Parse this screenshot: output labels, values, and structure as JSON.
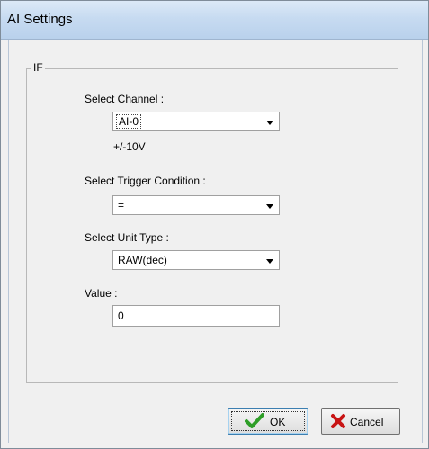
{
  "window": {
    "title": "AI Settings"
  },
  "group": {
    "label": "IF"
  },
  "channel": {
    "label": "Select Channel :",
    "value": "AI-0",
    "range_text": "+/-10V"
  },
  "trigger": {
    "label": "Select Trigger Condition :",
    "value": "="
  },
  "unit": {
    "label": "Select Unit Type :",
    "value": "RAW(dec)"
  },
  "value_field": {
    "label": "Value :",
    "value": "0"
  },
  "buttons": {
    "ok": {
      "label": "OK",
      "icon": "checkmark-icon",
      "icon_color": "#2e9e28"
    },
    "cancel": {
      "label": "Cancel",
      "icon": "red-x-icon",
      "icon_color": "#c81414"
    }
  }
}
